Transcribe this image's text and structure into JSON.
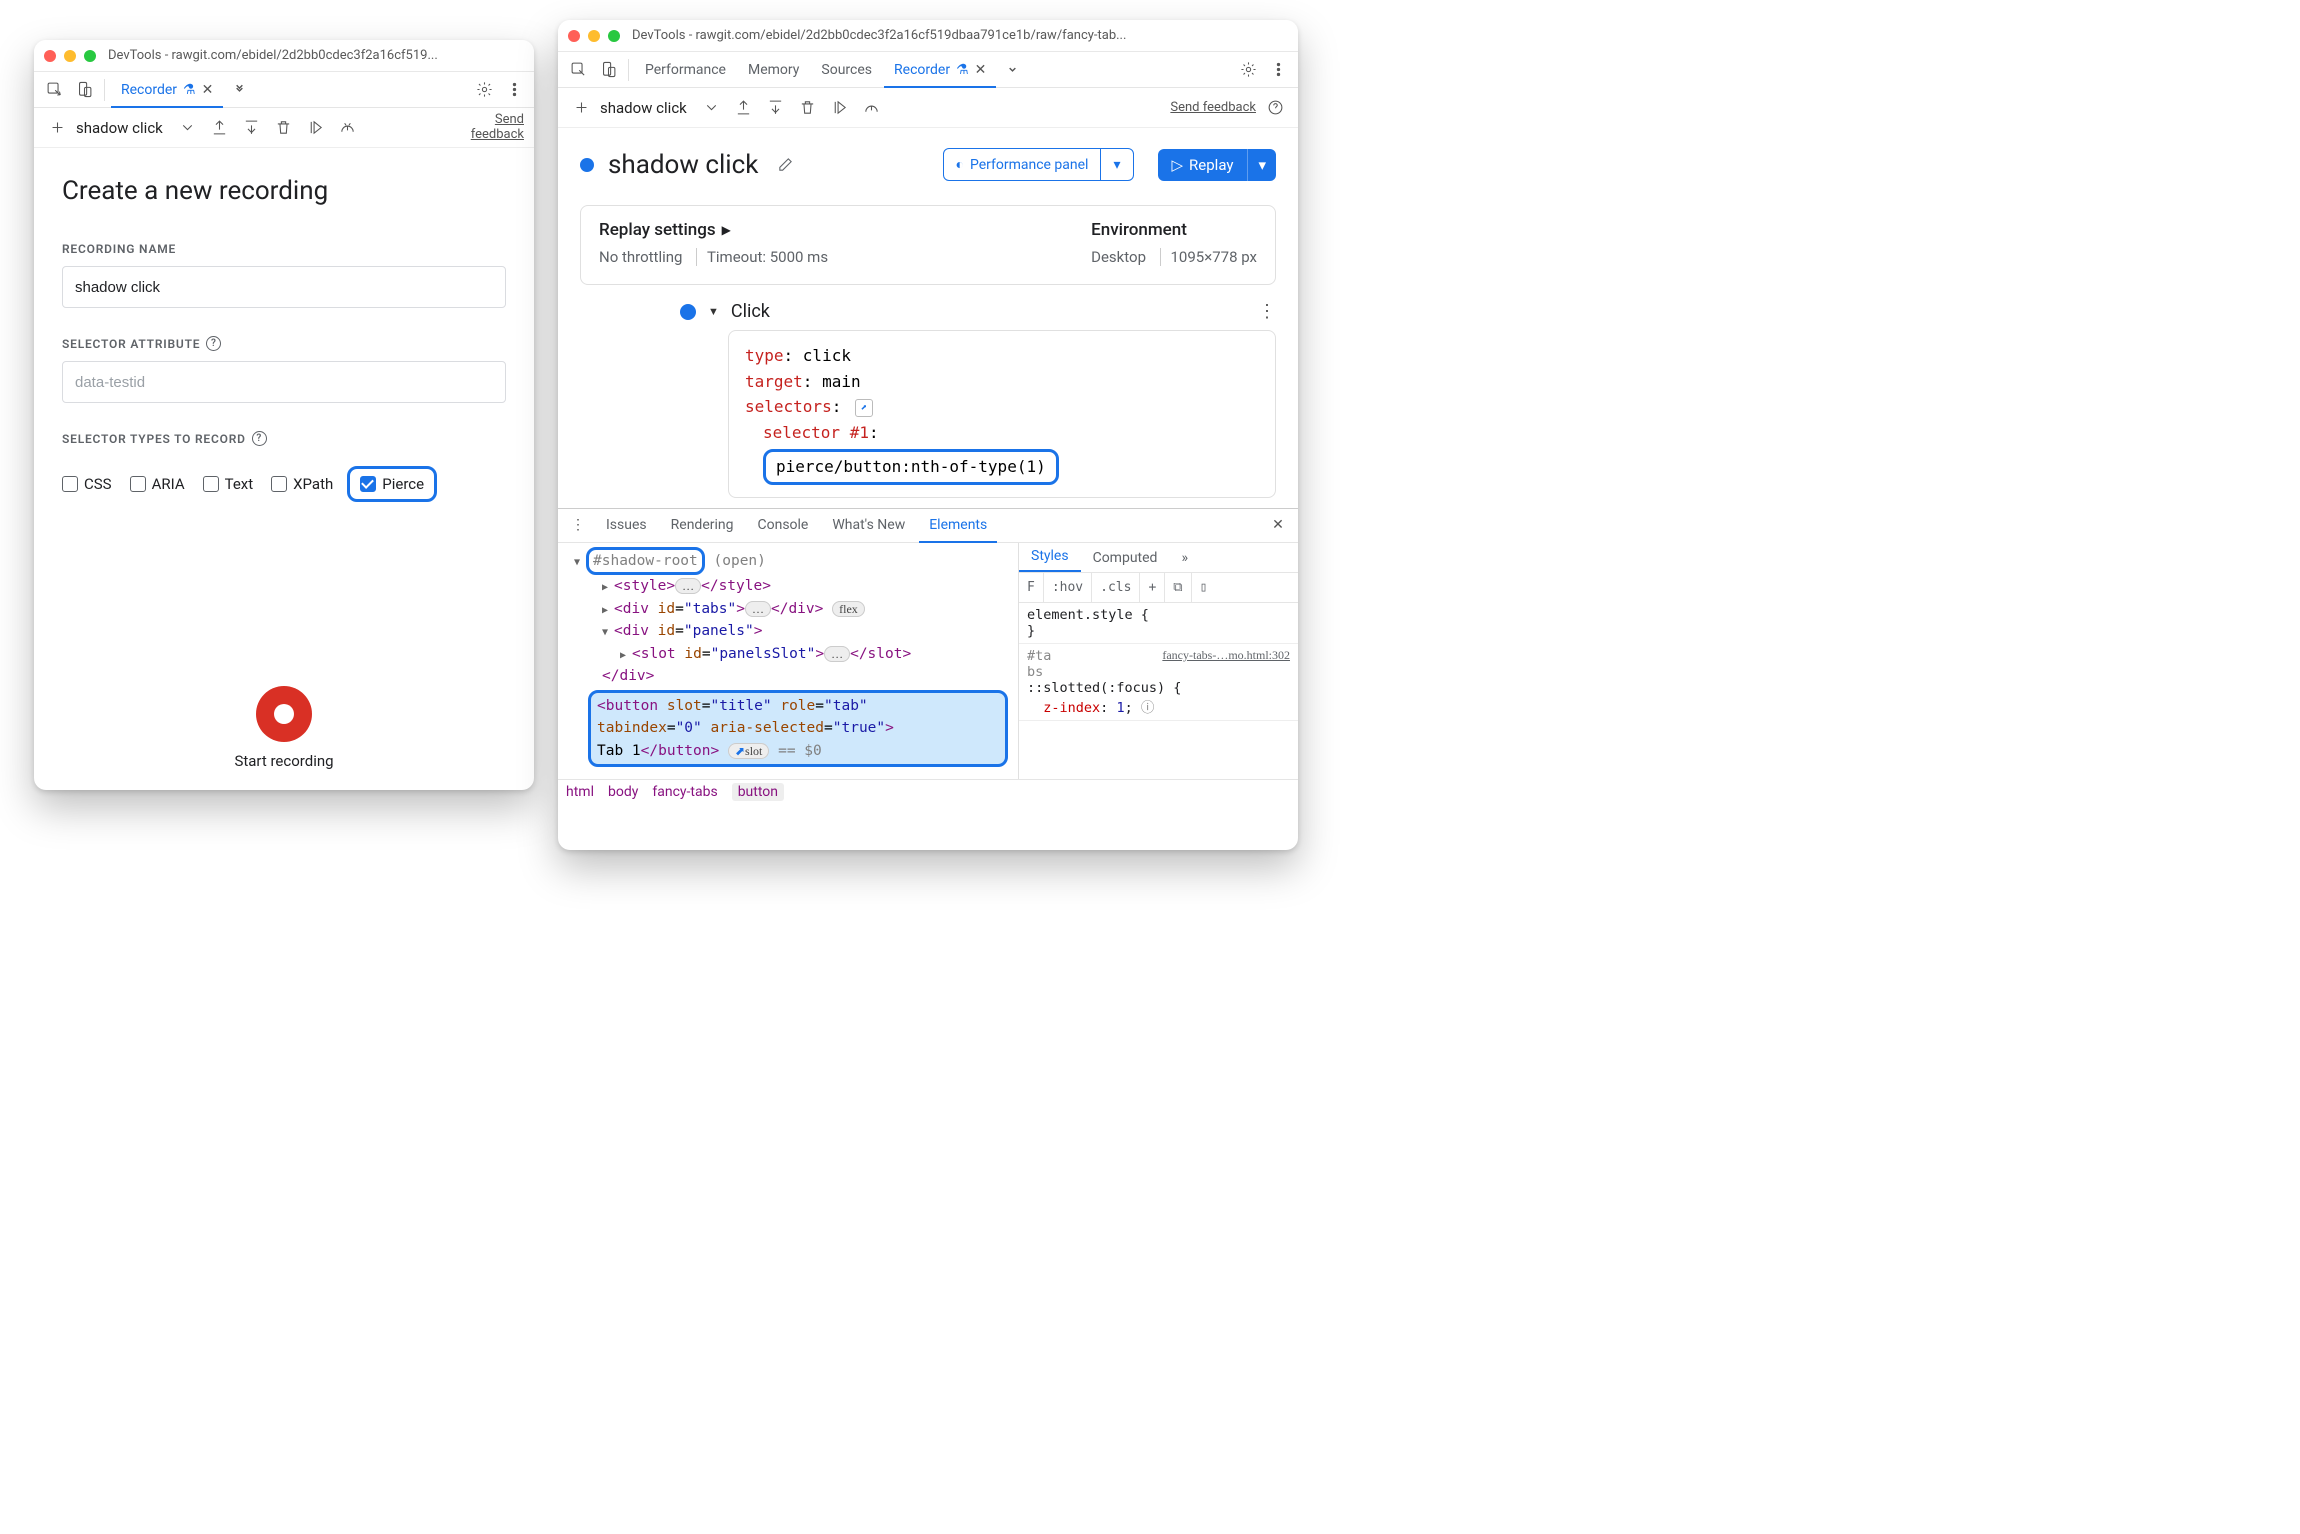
{
  "left": {
    "title": "DevTools - rawgit.com/ebidel/2d2bb0cdec3f2a16cf519...",
    "tab_recorder": "Recorder",
    "flow_name": "shadow click",
    "send_feedback": "Send feedback",
    "heading": "Create a new recording",
    "label_recording_name": "RECORDING NAME",
    "input_recording_name": "shadow click",
    "label_selector_attribute": "SELECTOR ATTRIBUTE",
    "placeholder_selector_attribute": "data-testid",
    "label_selector_types": "SELECTOR TYPES TO RECORD",
    "types": {
      "css": "CSS",
      "aria": "ARIA",
      "text": "Text",
      "xpath": "XPath",
      "pierce": "Pierce"
    },
    "start_recording": "Start recording"
  },
  "right": {
    "title": "DevTools - rawgit.com/ebidel/2d2bb0cdec3f2a16cf519dbaa791ce1b/raw/fancy-tab...",
    "tabs": {
      "performance": "Performance",
      "memory": "Memory",
      "sources": "Sources",
      "recorder": "Recorder"
    },
    "flow_name": "shadow click",
    "send_feedback": "Send feedback",
    "flow_title": "shadow click",
    "performance_panel": "Performance panel",
    "replay": "Replay",
    "settings": {
      "replay_title": "Replay settings",
      "throttle": "No throttling",
      "timeout": "Timeout: 5000 ms",
      "env_title": "Environment",
      "device": "Desktop",
      "viewport": "1095×778 px"
    },
    "step": {
      "name": "Click",
      "type_k": "type",
      "type_v": "click",
      "target_k": "target",
      "target_v": "main",
      "selectors_k": "selectors",
      "sel1_k": "selector #1",
      "sel1_v": "pierce/button:nth-of-type(1)"
    },
    "drawer": {
      "tabs": {
        "issues": "Issues",
        "rendering": "Rendering",
        "console": "Console",
        "whatsnew": "What's New",
        "elements": "Elements"
      },
      "shadow_root": "#shadow-root",
      "shadow_open": "(open)",
      "flex": "flex",
      "slot_badge": "slot",
      "dollar0": "== $0",
      "button_text": "Tab 1"
    },
    "styles": {
      "tabs": {
        "styles": "Styles",
        "computed": "Computed"
      },
      "filter_hint": "F",
      "hov": ":hov",
      "cls": ".cls",
      "rule1": "element.style {",
      "rule2_sel": "#ta\nbs",
      "rule2_src": "fancy-tabs-…mo.html:302",
      "rule2_sel2": "::slotted(:focus) {",
      "rule2_prop": "z-index",
      "rule2_val": "1"
    },
    "crumbs": [
      "html",
      "body",
      "fancy-tabs",
      "button"
    ]
  }
}
